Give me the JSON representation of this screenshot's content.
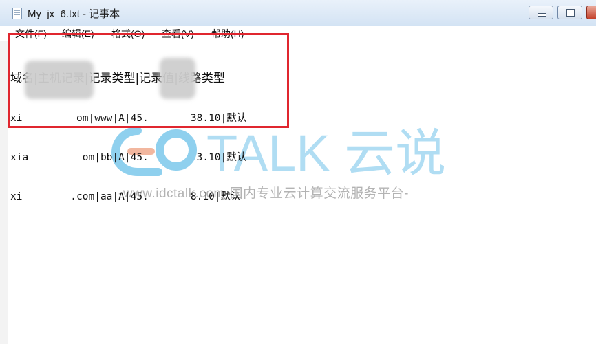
{
  "window": {
    "title": "My_jx_6.txt - 记事本"
  },
  "menu": [
    "文件(F)",
    "编辑(E)",
    "格式(O)",
    "查看(V)",
    "帮助(H)"
  ],
  "content": {
    "header": "域名|主机记录|记录类型|记录值|线路类型",
    "rows": [
      "xi         om|www|A|45.       38.10|默认",
      "xia         om|bb|A|45.        3.10|默认",
      "xi        .com|aa|A|45.       8.10|默认"
    ]
  },
  "watermark": {
    "logo_text": "TALK 云说",
    "url_text": "-www.idctalk.com-国内专业云计算交流服务平台-"
  },
  "colors": {
    "highlight_border": "#e0262f",
    "watermark_blue": "#8fd0ee",
    "watermark_gray": "#bdbdbd"
  }
}
